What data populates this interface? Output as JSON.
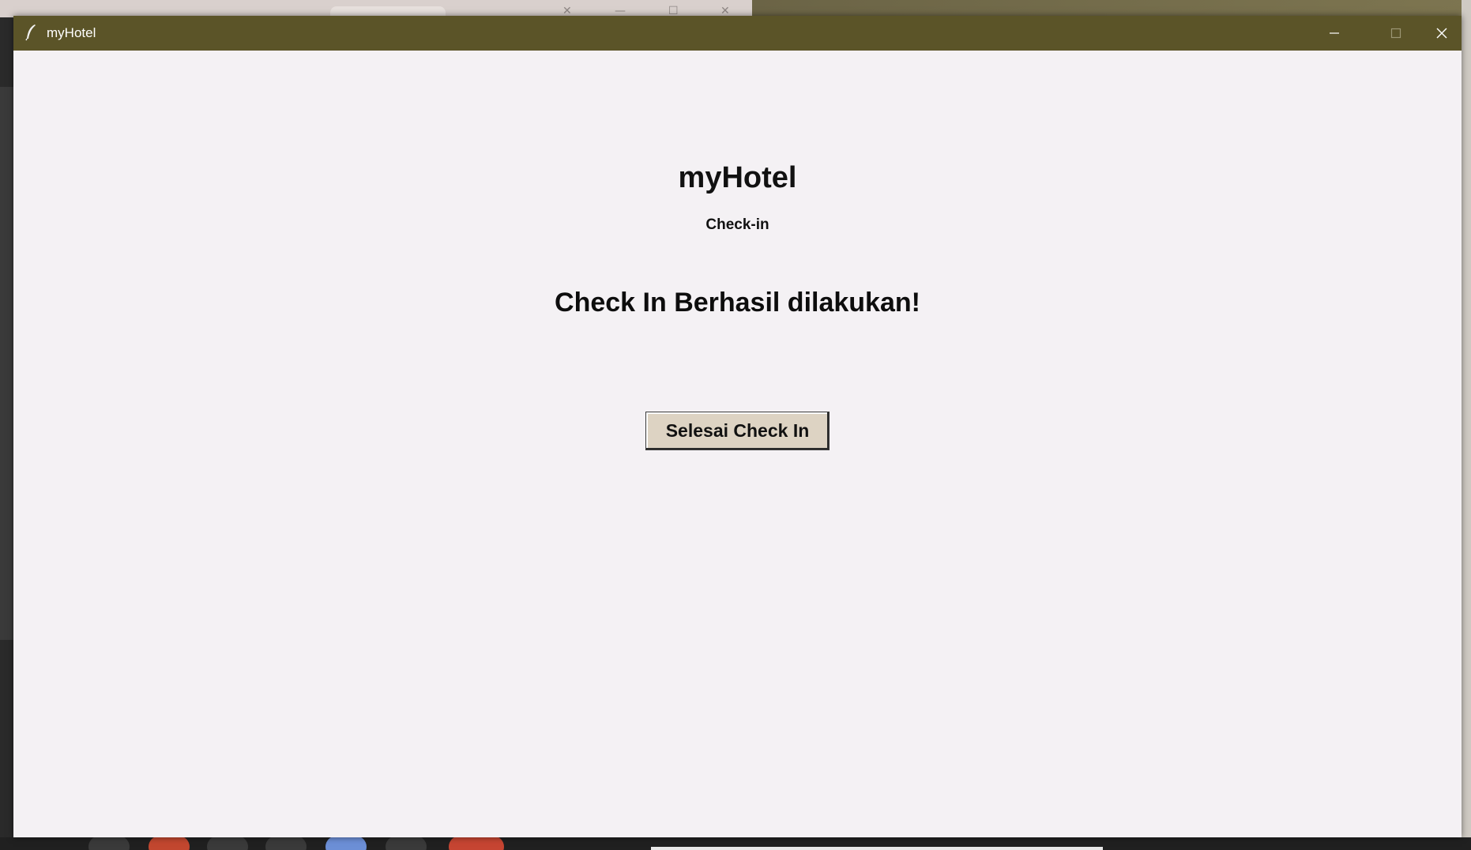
{
  "window": {
    "title": "myHotel",
    "title_bar_color": "#5b5428",
    "background_color": "#f4f1f4"
  },
  "header": {
    "app_title": "myHotel",
    "subtitle": "Check-in"
  },
  "main": {
    "message": "Check In Berhasil dilakukan!",
    "finish_button_label": "Selesai Check In",
    "button_color": "#ddd3c3"
  },
  "controls": {
    "minimize_icon": "minimize-icon",
    "maximize_icon": "maximize-icon",
    "close_icon": "close-icon",
    "app_icon": "feather-icon"
  }
}
